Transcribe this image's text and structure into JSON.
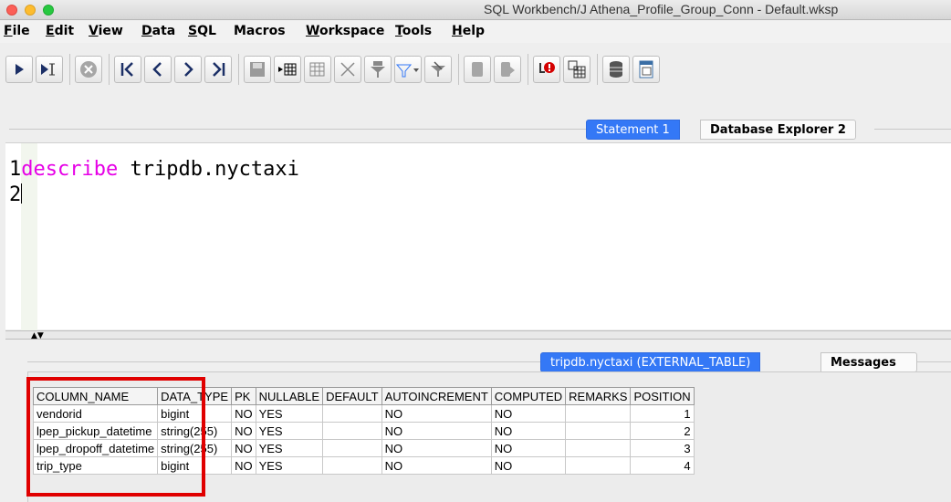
{
  "window": {
    "title": "SQL Workbench/J Athena_Profile_Group_Conn - Default.wksp"
  },
  "menu": [
    {
      "label": "File",
      "mnemonic": "F",
      "rest": "ile"
    },
    {
      "label": "Edit",
      "mnemonic": "E",
      "rest": "dit"
    },
    {
      "label": "View",
      "mnemonic": "V",
      "rest": "iew"
    },
    {
      "label": "Data",
      "mnemonic": "D",
      "rest": "ata"
    },
    {
      "label": "SQL",
      "mnemonic": "S",
      "rest": "QL"
    },
    {
      "label": "Macros",
      "mnemonic": "",
      "rest": "Macros"
    },
    {
      "label": "Workspace",
      "mnemonic": "W",
      "rest": "orkspace"
    },
    {
      "label": "Tools",
      "mnemonic": "T",
      "rest": "ools"
    },
    {
      "label": "Help",
      "mnemonic": "H",
      "rest": "elp"
    }
  ],
  "toolbar": {
    "icons": [
      "execute-icon",
      "execute-current-icon",
      "stop-icon",
      "first-icon",
      "previous-icon",
      "next-icon",
      "last-icon",
      "save-icon",
      "insert-row-icon",
      "copy-row-icon",
      "delete-icon",
      "filter-icon",
      "filter-dropdown-icon",
      "reset-filter-icon",
      "commit-icon",
      "rollback-icon",
      "autocommit-error-icon",
      "grid-icon",
      "database-icon",
      "table-icon"
    ]
  },
  "editor_tabs": {
    "active": "Statement 1",
    "inactive": "Database Explorer 2"
  },
  "editor": {
    "lines": [
      {
        "number": "1",
        "keyword": "describe",
        "text": " tripdb.nyctaxi"
      },
      {
        "number": "2",
        "keyword": "",
        "text": ""
      }
    ]
  },
  "result_tabs": {
    "active": "tripdb.nyctaxi (EXTERNAL_TABLE)",
    "inactive": "Messages"
  },
  "result_table": {
    "columns": [
      "COLUMN_NAME",
      "DATA_TYPE",
      "PK",
      "NULLABLE",
      "DEFAULT",
      "AUTOINCREMENT",
      "COMPUTED",
      "REMARKS",
      "POSITION"
    ],
    "rows": [
      [
        "vendorid",
        "bigint",
        "NO",
        "YES",
        "",
        "NO",
        "NO",
        "",
        "1"
      ],
      [
        "lpep_pickup_datetime",
        "string(255)",
        "NO",
        "YES",
        "",
        "NO",
        "NO",
        "",
        "2"
      ],
      [
        "lpep_dropoff_datetime",
        "string(255)",
        "NO",
        "YES",
        "",
        "NO",
        "NO",
        "",
        "3"
      ],
      [
        "trip_type",
        "bigint",
        "NO",
        "YES",
        "",
        "NO",
        "NO",
        "",
        "4"
      ]
    ]
  },
  "colors": {
    "accent": "#3478f6",
    "keyword": "#e600e6",
    "highlight": "#e00000"
  }
}
